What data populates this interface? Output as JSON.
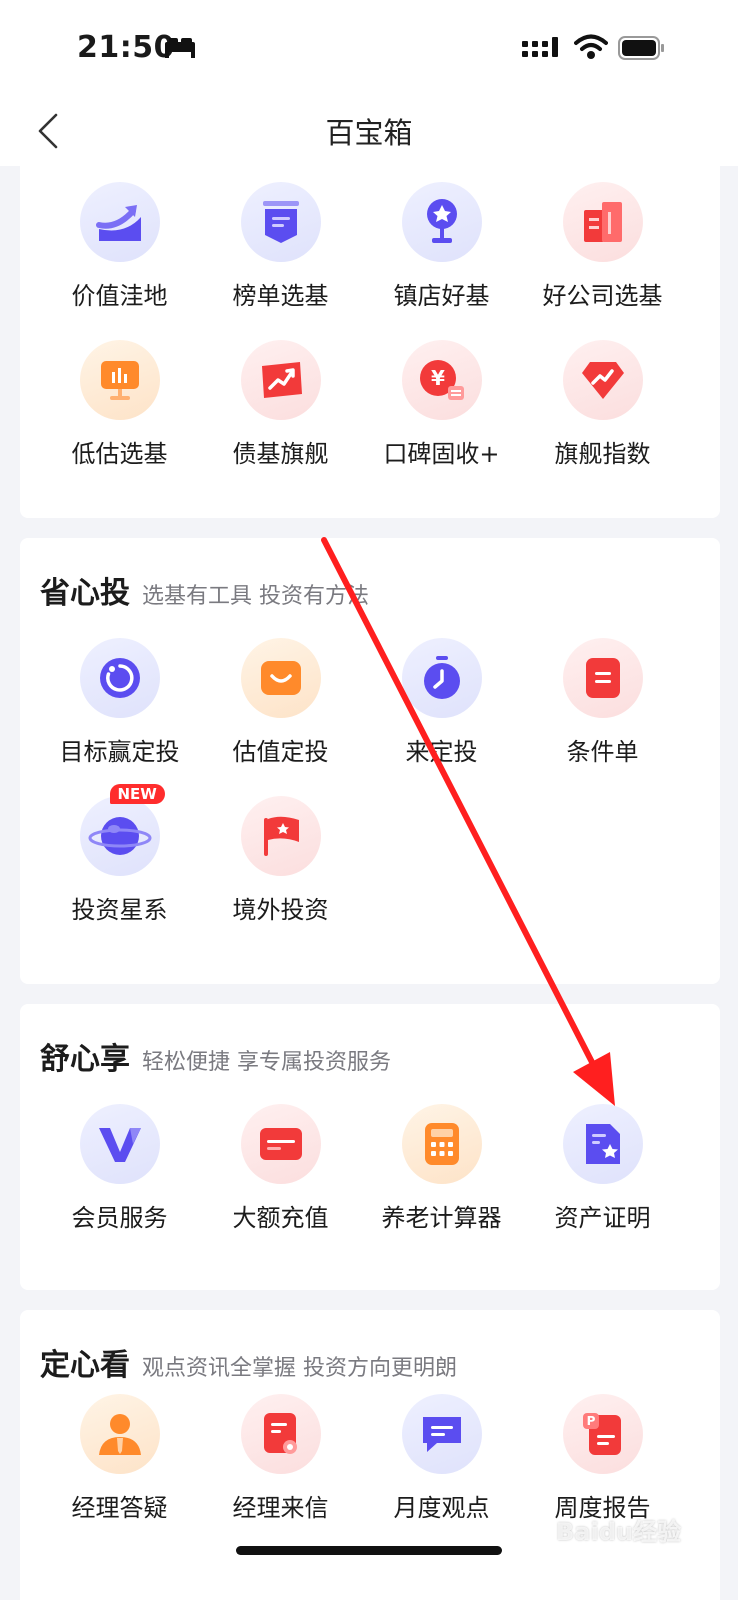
{
  "status_bar": {
    "time": "21:50"
  },
  "nav": {
    "title": "百宝箱"
  },
  "sections": [
    {
      "items": [
        {
          "label": "价值洼地",
          "icon": "value-chart-icon"
        },
        {
          "label": "榜单选基",
          "icon": "ranking-icon"
        },
        {
          "label": "镇店好基",
          "icon": "trophy-icon"
        },
        {
          "label": "好公司选基",
          "icon": "company-building-icon"
        },
        {
          "label": "低估选基",
          "icon": "low-valuation-board-icon"
        },
        {
          "label": "债基旗舰",
          "icon": "bond-trend-icon"
        },
        {
          "label": "口碑固收+",
          "icon": "yuan-coin-icon"
        },
        {
          "label": "旗舰指数",
          "icon": "diamond-index-icon"
        }
      ]
    },
    {
      "title": "省心投",
      "subtitle": "选基有工具 投资有方法",
      "items": [
        {
          "label": "目标赢定投",
          "icon": "target-cycle-icon"
        },
        {
          "label": "估值定投",
          "icon": "valuation-smile-icon"
        },
        {
          "label": "来定投",
          "icon": "stopwatch-icon"
        },
        {
          "label": "条件单",
          "icon": "order-doc-icon"
        },
        {
          "label": "投资星系",
          "icon": "planet-icon",
          "badge": "NEW"
        },
        {
          "label": "境外投资",
          "icon": "flag-icon"
        }
      ]
    },
    {
      "title": "舒心享",
      "subtitle": "轻松便捷 享专属投资服务",
      "items": [
        {
          "label": "会员服务",
          "icon": "vip-v-icon"
        },
        {
          "label": "大额充值",
          "icon": "bank-card-icon"
        },
        {
          "label": "养老计算器",
          "icon": "calculator-icon"
        },
        {
          "label": "资产证明",
          "icon": "asset-certificate-icon"
        }
      ]
    },
    {
      "title": "定心看",
      "subtitle": "观点资讯全掌握 投资方向更明朗",
      "items": [
        {
          "label": "经理答疑",
          "icon": "manager-avatar-icon"
        },
        {
          "label": "经理来信",
          "icon": "letter-icon"
        },
        {
          "label": "月度观点",
          "icon": "chat-bubble-icon"
        },
        {
          "label": "周度报告",
          "icon": "report-ppt-icon"
        }
      ]
    }
  ],
  "watermark": "Baidu经验",
  "colors": {
    "blue_icon": "#5b4df0",
    "red_icon": "#f23a3a",
    "orange_icon": "#ff8a2b",
    "annotation_arrow": "#ff1f1f"
  }
}
